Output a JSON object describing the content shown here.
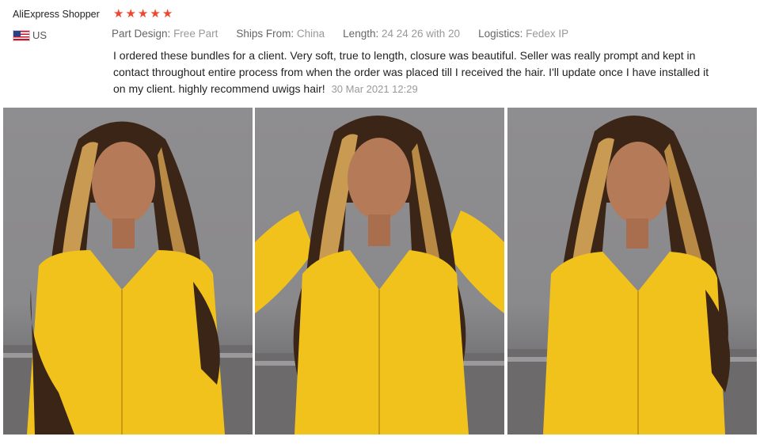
{
  "review": {
    "reviewer": "AliExpress Shopper",
    "rating": 5,
    "star_icon": "★",
    "country": "US",
    "attributes": [
      {
        "key": "Part Design:",
        "value": "Free Part"
      },
      {
        "key": "Ships From:",
        "value": "China"
      },
      {
        "key": "Length:",
        "value": "24 24 26 with 20"
      },
      {
        "key": "Logistics:",
        "value": "Fedex IP"
      }
    ],
    "text": "I ordered these bundles for a client. Very soft, true to length, closure was beautiful. Seller was really prompt and kept in contact throughout entire process from when the order was placed till I received the hair. I'll update once I have installed it on my client. highly recommend uwigs hair!",
    "date": "30 Mar 2021 12:29"
  },
  "photos": [
    {
      "name": "review-photo-1"
    },
    {
      "name": "review-photo-2"
    },
    {
      "name": "review-photo-3"
    }
  ],
  "colors": {
    "star": "#f0462d",
    "jacket": "#f2c21c",
    "hair_dark": "#3a2517",
    "hair_highlight": "#c99a52",
    "skin": "#b57a58",
    "background": "#8c8b8d"
  }
}
